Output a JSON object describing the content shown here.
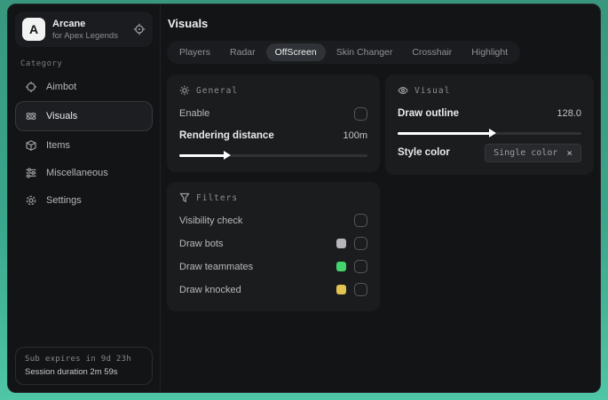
{
  "brand": {
    "logo_letter": "A",
    "name": "Arcane",
    "subtitle": "for Apex Legends"
  },
  "sidebar": {
    "category_label": "Category",
    "items": [
      {
        "label": "Aimbot",
        "icon": "crosshair-icon"
      },
      {
        "label": "Visuals",
        "icon": "atom-icon",
        "active": true
      },
      {
        "label": "Items",
        "icon": "box-icon"
      },
      {
        "label": "Miscellaneous",
        "icon": "sliders-icon"
      },
      {
        "label": "Settings",
        "icon": "gear-icon"
      }
    ],
    "status": {
      "expires": "Sub expires in 9d 23h",
      "session": "Session duration 2m 59s"
    }
  },
  "main": {
    "title": "Visuals",
    "active_tab": "OffScreen",
    "tabs": [
      {
        "label": "Players"
      },
      {
        "label": "Radar"
      },
      {
        "label": "OffScreen"
      },
      {
        "label": "Skin Changer"
      },
      {
        "label": "Crosshair"
      },
      {
        "label": "Highlight"
      }
    ]
  },
  "panels": {
    "general": {
      "title": "General",
      "enable_label": "Enable",
      "enable_checked": false,
      "rendering_distance_label": "Rendering distance",
      "rendering_distance_value": "100m",
      "rendering_distance_fill_percent": 24
    },
    "visual": {
      "title": "Visual",
      "draw_outline_label": "Draw outline",
      "draw_outline_value": "128.0",
      "draw_outline_fill_percent": 50,
      "style_color_label": "Style color",
      "style_color_value": "Single color",
      "style_color_clear": "×"
    },
    "filters": {
      "title": "Filters",
      "rows": [
        {
          "label": "Visibility check",
          "checked": false
        },
        {
          "label": "Draw bots",
          "swatch": "#b5b5ba",
          "checked": false
        },
        {
          "label": "Draw teammates",
          "swatch": "#43d56c",
          "checked": false
        },
        {
          "label": "Draw knocked",
          "swatch": "#e2c452",
          "checked": false
        }
      ]
    }
  },
  "colors": {
    "desktop_teal": "#3aa68b",
    "swatch_gray": "#b5b5ba",
    "swatch_green": "#43d56c",
    "swatch_yellow": "#e2c452"
  }
}
